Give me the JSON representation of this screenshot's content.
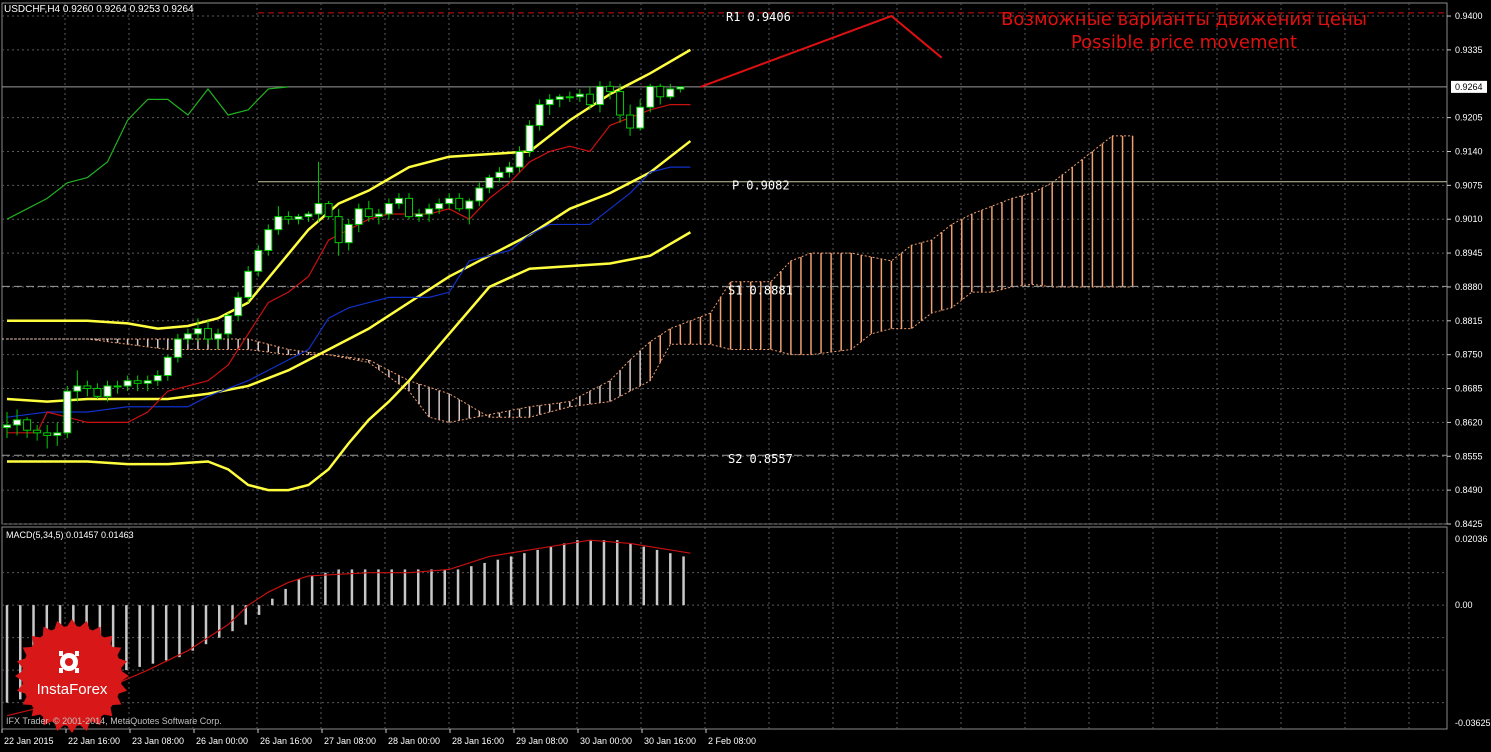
{
  "header": {
    "symbol_tf": "USDCHF,H4",
    "ohlc": "0.9260 0.9264 0.9253 0.9264"
  },
  "note": {
    "ru": "Возможные варианты движения цены",
    "en": "Possible price movement"
  },
  "levels": [
    {
      "label": "R1",
      "value": "0.9406"
    },
    {
      "label": "P",
      "value": "0.9082"
    },
    {
      "label": "S1",
      "value": "0.8881"
    },
    {
      "label": "S2",
      "value": "0.8557"
    }
  ],
  "current_price": "0.9264",
  "price_ticks": [
    "0.9400",
    "0.9335",
    "0.9205",
    "0.9140",
    "0.9075",
    "0.9010",
    "0.8945",
    "0.8880",
    "0.8815",
    "0.8750",
    "0.8685",
    "0.8620",
    "0.8555",
    "0.8490",
    "0.8425"
  ],
  "macd": {
    "label": "MACD(5,34,5) 0.01457 0.01463",
    "ticks": [
      "0.02036",
      "0.00",
      "-0.03625"
    ]
  },
  "time_ticks": [
    "22 Jan 2015",
    "22 Jan 16:00",
    "23 Jan 08:00",
    "26 Jan 00:00",
    "26 Jan 16:00",
    "27 Jan 08:00",
    "28 Jan 00:00",
    "28 Jan 16:00",
    "29 Jan 08:00",
    "30 Jan 00:00",
    "30 Jan 16:00",
    "2 Feb 08:00"
  ],
  "copyright": "IFX Trader, © 2001-2014, MetaQuotes Software Corp.",
  "logo_text": "InstaForex",
  "colors": {
    "bg": "#000000",
    "grid": "#5a5a5a",
    "bollinger": "#ffff40",
    "tenkan": "#cc1010",
    "kijun": "#1030c8",
    "chikou": "#20b020",
    "cloud_up": "#f0a070",
    "cloud_down": "#d8c8c8",
    "macd_hist": "#c8c8c8",
    "macd_signal": "#c81010",
    "note": "#e01010",
    "bull_candle": "#ffffff",
    "candle_outline": "#00cc00"
  },
  "chart_data": {
    "type": "candlestick",
    "symbol": "USDCHF",
    "timeframe": "H4",
    "last_ohlc": {
      "open": 0.926,
      "high": 0.9264,
      "low": 0.9253,
      "close": 0.9264
    },
    "y_range": [
      0.8425,
      0.9425
    ],
    "candles_ohlc": [
      [
        0.861,
        0.864,
        0.859,
        0.8615
      ],
      [
        0.8615,
        0.8645,
        0.8595,
        0.8625
      ],
      [
        0.8625,
        0.863,
        0.859,
        0.8605
      ],
      [
        0.8605,
        0.8615,
        0.8585,
        0.86
      ],
      [
        0.86,
        0.8615,
        0.857,
        0.8595
      ],
      [
        0.8595,
        0.862,
        0.8575,
        0.86
      ],
      [
        0.86,
        0.869,
        0.859,
        0.868
      ],
      [
        0.868,
        0.872,
        0.866,
        0.869
      ],
      [
        0.869,
        0.87,
        0.867,
        0.8685
      ],
      [
        0.8685,
        0.8695,
        0.8665,
        0.867
      ],
      [
        0.867,
        0.87,
        0.866,
        0.869
      ],
      [
        0.869,
        0.87,
        0.8675,
        0.869
      ],
      [
        0.869,
        0.871,
        0.868,
        0.87
      ],
      [
        0.87,
        0.871,
        0.868,
        0.8695
      ],
      [
        0.8695,
        0.871,
        0.868,
        0.87
      ],
      [
        0.87,
        0.872,
        0.869,
        0.871
      ],
      [
        0.871,
        0.875,
        0.87,
        0.8745
      ],
      [
        0.8745,
        0.879,
        0.8735,
        0.878
      ],
      [
        0.878,
        0.88,
        0.877,
        0.879
      ],
      [
        0.879,
        0.882,
        0.8775,
        0.88
      ],
      [
        0.88,
        0.8815,
        0.877,
        0.878
      ],
      [
        0.878,
        0.88,
        0.876,
        0.879
      ],
      [
        0.879,
        0.883,
        0.878,
        0.8825
      ],
      [
        0.8825,
        0.887,
        0.8815,
        0.886
      ],
      [
        0.886,
        0.892,
        0.885,
        0.891
      ],
      [
        0.891,
        0.896,
        0.89,
        0.895
      ],
      [
        0.895,
        0.9,
        0.894,
        0.899
      ],
      [
        0.899,
        0.9035,
        0.898,
        0.9015
      ],
      [
        0.9015,
        0.9025,
        0.9,
        0.901
      ],
      [
        0.901,
        0.902,
        0.9,
        0.9015
      ],
      [
        0.9015,
        0.9025,
        0.9005,
        0.902
      ],
      [
        0.902,
        0.912,
        0.9005,
        0.904
      ],
      [
        0.904,
        0.9045,
        0.901,
        0.9015
      ],
      [
        0.9015,
        0.903,
        0.894,
        0.8965
      ],
      [
        0.8965,
        0.901,
        0.895,
        0.9
      ],
      [
        0.9,
        0.904,
        0.8985,
        0.903
      ],
      [
        0.903,
        0.9045,
        0.9005,
        0.9015
      ],
      [
        0.9015,
        0.903,
        0.9,
        0.902
      ],
      [
        0.902,
        0.905,
        0.901,
        0.904
      ],
      [
        0.904,
        0.906,
        0.903,
        0.905
      ],
      [
        0.905,
        0.906,
        0.901,
        0.9015
      ],
      [
        0.9015,
        0.903,
        0.9005,
        0.902
      ],
      [
        0.902,
        0.904,
        0.9005,
        0.903
      ],
      [
        0.903,
        0.905,
        0.902,
        0.904
      ],
      [
        0.904,
        0.906,
        0.903,
        0.905
      ],
      [
        0.905,
        0.906,
        0.9025,
        0.903
      ],
      [
        0.903,
        0.905,
        0.9,
        0.9045
      ],
      [
        0.9045,
        0.908,
        0.9035,
        0.907
      ],
      [
        0.907,
        0.9095,
        0.906,
        0.909
      ],
      [
        0.909,
        0.911,
        0.908,
        0.91
      ],
      [
        0.91,
        0.912,
        0.909,
        0.911
      ],
      [
        0.911,
        0.915,
        0.91,
        0.914
      ],
      [
        0.914,
        0.92,
        0.913,
        0.919
      ],
      [
        0.919,
        0.924,
        0.918,
        0.923
      ],
      [
        0.923,
        0.925,
        0.921,
        0.924
      ],
      [
        0.924,
        0.925,
        0.9225,
        0.9245
      ],
      [
        0.9245,
        0.9255,
        0.9235,
        0.9245
      ],
      [
        0.9245,
        0.926,
        0.9235,
        0.925
      ],
      [
        0.925,
        0.9265,
        0.922,
        0.923
      ],
      [
        0.923,
        0.9275,
        0.9215,
        0.9265
      ],
      [
        0.9265,
        0.9275,
        0.924,
        0.9255
      ],
      [
        0.9255,
        0.927,
        0.9195,
        0.921
      ],
      [
        0.921,
        0.923,
        0.917,
        0.9185
      ],
      [
        0.9185,
        0.924,
        0.918,
        0.9225
      ],
      [
        0.9225,
        0.927,
        0.9215,
        0.9265
      ],
      [
        0.9265,
        0.927,
        0.923,
        0.9245
      ],
      [
        0.9245,
        0.927,
        0.924,
        0.926
      ],
      [
        0.926,
        0.9264,
        0.9253,
        0.9264
      ]
    ],
    "bollinger_upper": [
      [
        0,
        0.8815
      ],
      [
        4,
        0.8815
      ],
      [
        8,
        0.8815
      ],
      [
        12,
        0.881
      ],
      [
        15,
        0.88
      ],
      [
        18,
        0.8805
      ],
      [
        21,
        0.882
      ],
      [
        24,
        0.885
      ],
      [
        27,
        0.892
      ],
      [
        30,
        0.899
      ],
      [
        33,
        0.904
      ],
      [
        36,
        0.9065
      ],
      [
        40,
        0.911
      ],
      [
        44,
        0.913
      ],
      [
        48,
        0.9135
      ],
      [
        52,
        0.914
      ],
      [
        56,
        0.92
      ],
      [
        60,
        0.925
      ],
      [
        64,
        0.929
      ],
      [
        68,
        0.9335
      ]
    ],
    "bollinger_middle": [
      [
        0,
        0.8665
      ],
      [
        4,
        0.866
      ],
      [
        8,
        0.8665
      ],
      [
        12,
        0.8665
      ],
      [
        16,
        0.8665
      ],
      [
        20,
        0.8675
      ],
      [
        24,
        0.869
      ],
      [
        28,
        0.872
      ],
      [
        32,
        0.876
      ],
      [
        36,
        0.88
      ],
      [
        40,
        0.885
      ],
      [
        44,
        0.89
      ],
      [
        48,
        0.894
      ],
      [
        52,
        0.898
      ],
      [
        56,
        0.903
      ],
      [
        60,
        0.906
      ],
      [
        64,
        0.91
      ],
      [
        68,
        0.916
      ]
    ],
    "bollinger_lower": [
      [
        0,
        0.8545
      ],
      [
        4,
        0.8545
      ],
      [
        8,
        0.8545
      ],
      [
        12,
        0.854
      ],
      [
        16,
        0.854
      ],
      [
        20,
        0.8545
      ],
      [
        22,
        0.853
      ],
      [
        24,
        0.85
      ],
      [
        26,
        0.849
      ],
      [
        28,
        0.849
      ],
      [
        30,
        0.85
      ],
      [
        32,
        0.853
      ],
      [
        34,
        0.858
      ],
      [
        36,
        0.8625
      ],
      [
        38,
        0.866
      ],
      [
        40,
        0.87
      ],
      [
        44,
        0.879
      ],
      [
        48,
        0.888
      ],
      [
        52,
        0.8915
      ],
      [
        56,
        0.892
      ],
      [
        60,
        0.8925
      ],
      [
        64,
        0.894
      ],
      [
        68,
        0.8985
      ]
    ],
    "tenkan_sen": [
      [
        0,
        0.86
      ],
      [
        3,
        0.86
      ],
      [
        4,
        0.864
      ],
      [
        8,
        0.862
      ],
      [
        12,
        0.862
      ],
      [
        14,
        0.864
      ],
      [
        16,
        0.868
      ],
      [
        18,
        0.869
      ],
      [
        20,
        0.87
      ],
      [
        22,
        0.873
      ],
      [
        24,
        0.879
      ],
      [
        26,
        0.885
      ],
      [
        28,
        0.887
      ],
      [
        30,
        0.89
      ],
      [
        32,
        0.897
      ],
      [
        34,
        0.899
      ],
      [
        36,
        0.901
      ],
      [
        38,
        0.902
      ],
      [
        42,
        0.902
      ],
      [
        44,
        0.903
      ],
      [
        46,
        0.901
      ],
      [
        48,
        0.905
      ],
      [
        50,
        0.908
      ],
      [
        52,
        0.912
      ],
      [
        54,
        0.914
      ],
      [
        56,
        0.915
      ],
      [
        58,
        0.914
      ],
      [
        60,
        0.919
      ],
      [
        64,
        0.922
      ],
      [
        66,
        0.923
      ],
      [
        68,
        0.923
      ]
    ],
    "kijun_sen": [
      [
        0,
        0.863
      ],
      [
        4,
        0.864
      ],
      [
        8,
        0.864
      ],
      [
        12,
        0.865
      ],
      [
        16,
        0.865
      ],
      [
        18,
        0.865
      ],
      [
        20,
        0.867
      ],
      [
        24,
        0.87
      ],
      [
        28,
        0.874
      ],
      [
        30,
        0.876
      ],
      [
        32,
        0.882
      ],
      [
        34,
        0.884
      ],
      [
        36,
        0.885
      ],
      [
        38,
        0.886
      ],
      [
        42,
        0.886
      ],
      [
        44,
        0.887
      ],
      [
        46,
        0.893
      ],
      [
        48,
        0.894
      ],
      [
        50,
        0.895
      ],
      [
        52,
        0.898
      ],
      [
        54,
        0.9
      ],
      [
        56,
        0.9
      ],
      [
        58,
        0.9
      ],
      [
        60,
        0.903
      ],
      [
        62,
        0.906
      ],
      [
        64,
        0.91
      ],
      [
        66,
        0.911
      ],
      [
        68,
        0.911
      ]
    ],
    "chikou_span": [
      [
        0,
        0.901
      ],
      [
        2,
        0.903
      ],
      [
        4,
        0.905
      ],
      [
        6,
        0.908
      ],
      [
        8,
        0.909
      ],
      [
        10,
        0.912
      ],
      [
        12,
        0.92
      ],
      [
        14,
        0.924
      ],
      [
        16,
        0.924
      ],
      [
        18,
        0.921
      ],
      [
        20,
        0.926
      ],
      [
        22,
        0.921
      ],
      [
        24,
        0.922
      ],
      [
        26,
        0.926
      ],
      [
        28,
        0.9264
      ]
    ],
    "ichimoku_cloud": {
      "top": [
        [
          0,
          0.878
        ],
        [
          4,
          0.878
        ],
        [
          8,
          0.878
        ],
        [
          12,
          0.878
        ],
        [
          16,
          0.878
        ],
        [
          20,
          0.878
        ],
        [
          24,
          0.878
        ],
        [
          28,
          0.876
        ],
        [
          32,
          0.875
        ],
        [
          36,
          0.8735
        ],
        [
          40,
          0.868
        ],
        [
          42,
          0.863
        ],
        [
          44,
          0.862
        ],
        [
          48,
          0.8635
        ],
        [
          52,
          0.865
        ],
        [
          56,
          0.866
        ],
        [
          60,
          0.87
        ],
        [
          62,
          0.874
        ],
        [
          64,
          0.8775
        ],
        [
          66,
          0.88
        ],
        [
          68,
          0.8815
        ],
        [
          70,
          0.883
        ],
        [
          72,
          0.889
        ],
        [
          76,
          0.889
        ],
        [
          78,
          0.893
        ],
        [
          80,
          0.8945
        ],
        [
          84,
          0.8945
        ],
        [
          88,
          0.893
        ],
        [
          90,
          0.896
        ],
        [
          92,
          0.897
        ],
        [
          94,
          0.9
        ],
        [
          96,
          0.902
        ],
        [
          98,
          0.9035
        ],
        [
          100,
          0.905
        ],
        [
          102,
          0.906
        ],
        [
          104,
          0.908
        ],
        [
          106,
          0.911
        ],
        [
          108,
          0.914
        ],
        [
          110,
          0.917
        ],
        [
          112,
          0.917
        ]
      ],
      "bottom": [
        [
          0,
          0.878
        ],
        [
          4,
          0.878
        ],
        [
          8,
          0.878
        ],
        [
          12,
          0.877
        ],
        [
          16,
          0.876
        ],
        [
          20,
          0.876
        ],
        [
          24,
          0.876
        ],
        [
          28,
          0.875
        ],
        [
          32,
          0.875
        ],
        [
          36,
          0.874
        ],
        [
          40,
          0.87
        ],
        [
          44,
          0.8675
        ],
        [
          48,
          0.863
        ],
        [
          52,
          0.863
        ],
        [
          56,
          0.865
        ],
        [
          60,
          0.866
        ],
        [
          64,
          0.87
        ],
        [
          66,
          0.877
        ],
        [
          68,
          0.877
        ],
        [
          70,
          0.877
        ],
        [
          72,
          0.876
        ],
        [
          76,
          0.876
        ],
        [
          78,
          0.875
        ],
        [
          80,
          0.875
        ],
        [
          84,
          0.876
        ],
        [
          86,
          0.879
        ],
        [
          88,
          0.88
        ],
        [
          90,
          0.88
        ],
        [
          92,
          0.883
        ],
        [
          94,
          0.884
        ],
        [
          96,
          0.887
        ],
        [
          98,
          0.887
        ],
        [
          100,
          0.888
        ],
        [
          102,
          0.8885
        ],
        [
          104,
          0.888
        ],
        [
          106,
          0.888
        ],
        [
          108,
          0.888
        ],
        [
          110,
          0.888
        ],
        [
          112,
          0.888
        ]
      ]
    },
    "projection": [
      [
        69,
        0.9264
      ],
      [
        88,
        0.94
      ],
      [
        93,
        0.932
      ]
    ],
    "macd_histogram": [
      -0.03,
      -0.029,
      -0.028,
      -0.027,
      -0.025,
      -0.024,
      -0.023,
      -0.022,
      -0.021,
      -0.02,
      -0.019,
      -0.018,
      -0.017,
      -0.016,
      -0.014,
      -0.012,
      -0.01,
      -0.008,
      -0.006,
      -0.003,
      0.002,
      0.005,
      0.008,
      0.009,
      0.01,
      0.011,
      0.011,
      0.011,
      0.011,
      0.011,
      0.011,
      0.011,
      0.011,
      0.011,
      0.011,
      0.012,
      0.013,
      0.014,
      0.015,
      0.016,
      0.017,
      0.018,
      0.019,
      0.02,
      0.02,
      0.02,
      0.02,
      0.019,
      0.018,
      0.017,
      0.016,
      0.015
    ],
    "macd_signal": [
      [
        0,
        -0.034
      ],
      [
        8,
        -0.028
      ],
      [
        14,
        -0.02
      ],
      [
        18,
        -0.014
      ],
      [
        22,
        -0.006
      ],
      [
        24,
        0.0
      ],
      [
        26,
        0.004
      ],
      [
        28,
        0.007
      ],
      [
        30,
        0.009
      ],
      [
        36,
        0.01
      ],
      [
        40,
        0.01
      ],
      [
        44,
        0.011
      ],
      [
        48,
        0.015
      ],
      [
        52,
        0.017
      ],
      [
        56,
        0.019
      ],
      [
        58,
        0.02
      ],
      [
        62,
        0.019
      ],
      [
        66,
        0.017
      ],
      [
        68,
        0.016
      ]
    ],
    "macd_y_range": [
      -0.03625,
      0.02036
    ],
    "horizontal_lines": [
      0.9406,
      0.9264,
      0.9082,
      0.8881,
      0.8557
    ]
  }
}
